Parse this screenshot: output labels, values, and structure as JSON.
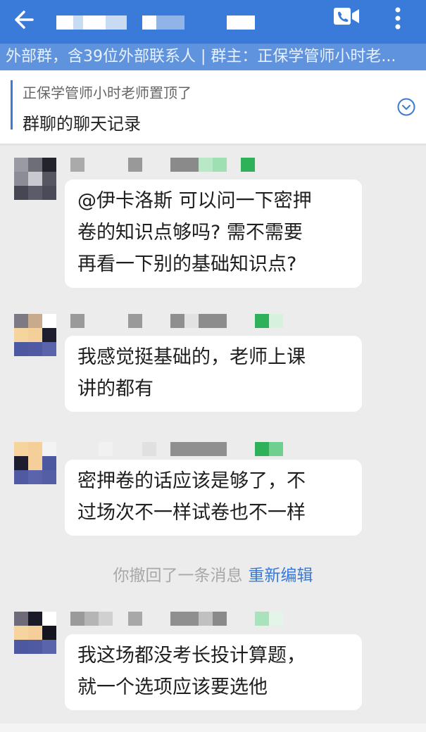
{
  "header": {
    "back_icon": "arrow-left-icon",
    "video_call_icon": "video-call-icon",
    "more_icon": "more-vertical-icon",
    "accent_color": "#3a7ad8"
  },
  "group_info": {
    "text": "外部群，含39位外部联系人 | 群主：正保学管师小时老..."
  },
  "pinned": {
    "by_text": "正保学管师小时老师置顶了",
    "content": "群聊的聊天记录",
    "expand_icon": "chevron-down-circle-icon"
  },
  "messages": [
    {
      "lines": [
        "@伊卡洛斯 可以问一下密押",
        "卷的知识点够吗? 需不需要",
        "再看一下别的基础知识点?"
      ]
    },
    {
      "lines": [
        "我感觉挺基础的，老师上课",
        "讲的都有"
      ]
    },
    {
      "lines": [
        "密押卷的话应该是够了，不",
        "过场次不一样试卷也不一样"
      ]
    },
    {
      "lines": [
        "我这场都没考长投计算题，",
        "就一个选项应该要选他"
      ]
    }
  ],
  "recall_notice": {
    "text": "你撤回了一条消息",
    "action": "重新编辑"
  }
}
